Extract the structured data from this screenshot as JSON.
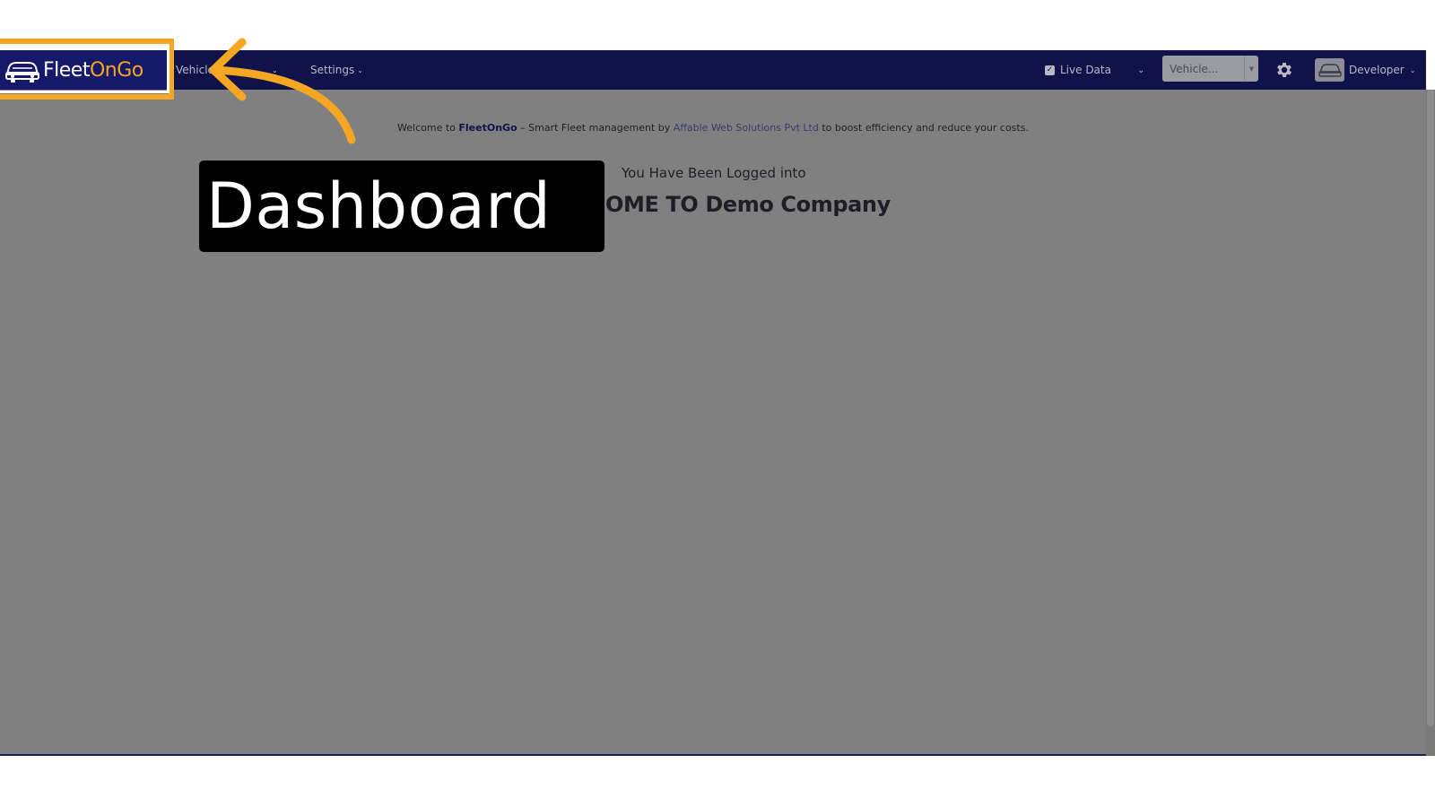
{
  "brand": {
    "prefix": "Fleet",
    "accent": "OnGo"
  },
  "nav": {
    "items": [
      {
        "label": "Vehicle"
      },
      {
        "label": "Settings"
      }
    ],
    "caret": "⌄"
  },
  "live_data": {
    "label": "Live Data",
    "checked": true
  },
  "vehicle_select": {
    "value": "Vehicle..."
  },
  "user": {
    "name": "Developer"
  },
  "welcome": {
    "prefix": "Welcome to ",
    "brand": "FleetOnGo",
    "middle": " – Smart Fleet management by ",
    "link": "Affable Web Solutions Pvt Ltd",
    "suffix": " to boost efficiency and reduce your costs."
  },
  "logged_in": {
    "text": "You Have Been Logged into"
  },
  "company": {
    "text": "OME TO Demo Company"
  },
  "callout": {
    "label": "Dashboard"
  },
  "colors": {
    "navbar": "#0f134a",
    "accent": "#f5a623",
    "overlay": "#808080",
    "callout_bg": "#000000"
  }
}
